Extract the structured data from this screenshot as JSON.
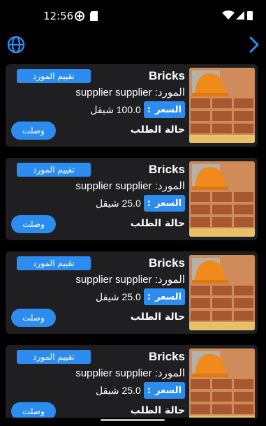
{
  "status_bar": {
    "time": "12:56"
  },
  "accent": "#2d8cf0",
  "icons": {
    "globe": "globe-icon",
    "next": "chevron-right-icon"
  },
  "cards": [
    {
      "title": "Bricks",
      "rate_label": "تقييم المورد",
      "supplier_text": "المورد: supplier supplier",
      "price_label": "السعر",
      "price_colon": ":",
      "price_value": "100.0 شيقل",
      "status_label": "حالة الطلب",
      "status_value": "وصلت"
    },
    {
      "title": "Bricks",
      "rate_label": "تقييم المورد",
      "supplier_text": "المورد: supplier supplier",
      "price_label": "السعر",
      "price_colon": ":",
      "price_value": "25.0 شيقل",
      "status_label": "حالة الطلب",
      "status_value": "وصلت"
    },
    {
      "title": "Bricks",
      "rate_label": "تقييم المورد",
      "supplier_text": "المورد: supplier supplier",
      "price_label": "السعر",
      "price_colon": ":",
      "price_value": "25.0 شيقل",
      "status_label": "حالة الطلب",
      "status_value": "وصلت"
    },
    {
      "title": "Bricks",
      "rate_label": "تقييم المورد",
      "supplier_text": "المورد: supplier supplier",
      "price_label": "السعر",
      "price_colon": ":",
      "price_value": "25.0 شيقل",
      "status_label": "حالة الطلب",
      "status_value": "وصلت"
    }
  ]
}
